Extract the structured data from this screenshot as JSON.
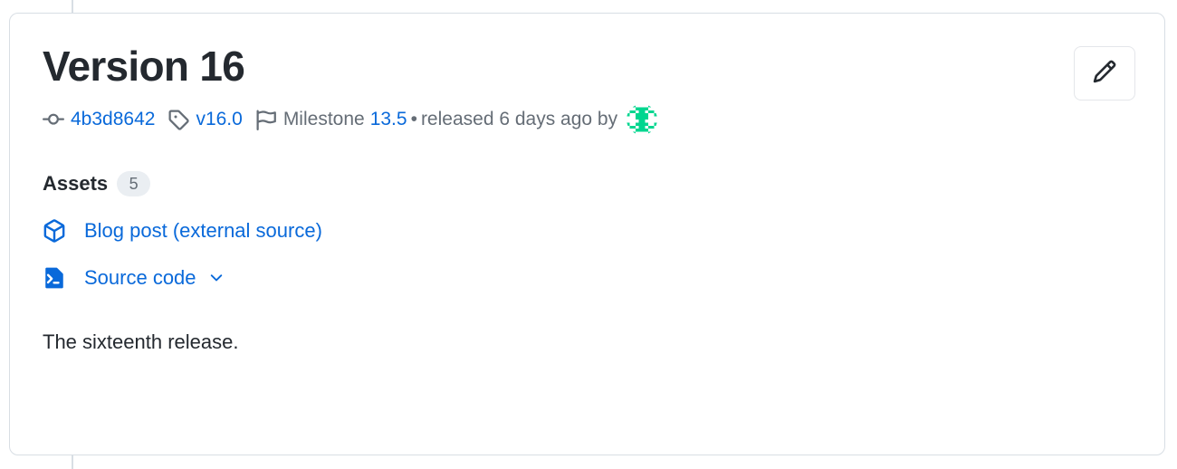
{
  "timeline": {
    "rail_color": "#d8dee4"
  },
  "card": {
    "border_color": "#d8dee4",
    "background": "#ffffff"
  },
  "release": {
    "title": "Version 16",
    "edit_button_label": "Edit release",
    "meta": {
      "commit_icon": "git-commit-icon",
      "commit_sha": "4b3d8642",
      "tag_icon": "tag-icon",
      "tag_name": "v16.0",
      "milestone_icon": "milestone-flag-icon",
      "milestone_label": "Milestone",
      "milestone_value": "13.5",
      "separator": "•",
      "released_text": "released 6 days ago by",
      "author_avatar": "identicon-avatar"
    },
    "assets": {
      "label": "Assets",
      "count": "5",
      "items": [
        {
          "icon": "package-icon",
          "label": "Blog post (external source)",
          "has_chevron": false
        },
        {
          "icon": "source-code-file-icon",
          "label": "Source code",
          "has_chevron": true,
          "chevron_icon": "chevron-down-icon"
        }
      ]
    },
    "body": "The sixteenth release."
  },
  "colors": {
    "link": "#0969da",
    "muted": "#656d76",
    "text": "#24292f",
    "badge_bg": "#eaeef2",
    "avatar_green": "#00d68f",
    "border": "#d8dee4"
  }
}
